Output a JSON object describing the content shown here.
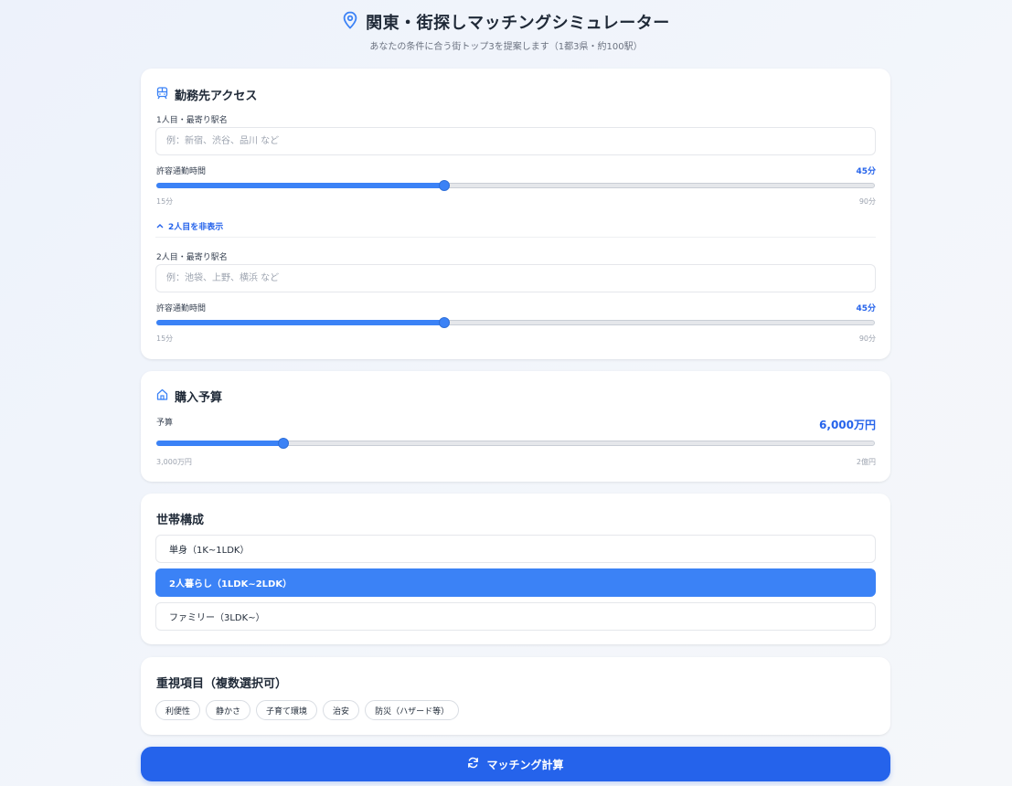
{
  "header": {
    "title": "関東・街探しマッチングシミュレーター",
    "subtitle": "あなたの条件に合う街トップ3を提案します（1都3県・約100駅）",
    "icon": "map-pin-icon"
  },
  "commute": {
    "title": "勤務先アクセス",
    "icon": "train-icon",
    "person1": {
      "station_label": "1人目・最寄り駅名",
      "station_placeholder": "例：新宿、渋谷、品川 など",
      "station_value": "",
      "time_label": "許容通勤時間",
      "time_value_text": "45分",
      "time_value": 45,
      "min": 15,
      "max": 90,
      "min_label": "15分",
      "max_label": "90分"
    },
    "toggle_label": "2人目を非表示",
    "person2": {
      "station_label": "2人目・最寄り駅名",
      "station_placeholder": "例：池袋、上野、横浜 など",
      "station_value": "",
      "time_label": "許容通勤時間",
      "time_value_text": "45分",
      "time_value": 45,
      "min": 15,
      "max": 90,
      "min_label": "15分",
      "max_label": "90分"
    }
  },
  "budget": {
    "title": "購入予算",
    "icon": "home-icon",
    "label": "予算",
    "value_text": "6,000万円",
    "value": 6000,
    "min": 3000,
    "max": 20000,
    "min_label": "3,000万円",
    "max_label": "2億円"
  },
  "household": {
    "title": "世帯構成",
    "options": [
      "単身（1K~1LDK）",
      "2人暮らし（1LDK~2LDK）",
      "ファミリー（3LDK~）"
    ],
    "selected": "2人暮らし（1LDK~2LDK）"
  },
  "priorities": {
    "title": "重視項目（複数選択可）",
    "chips": [
      "利便性",
      "静かさ",
      "子育て環境",
      "治安",
      "防災（ハザード等）"
    ]
  },
  "calculate_label": "マッチング計算",
  "colors": {
    "accent": "#3b82f6",
    "button": "#2563eb"
  }
}
